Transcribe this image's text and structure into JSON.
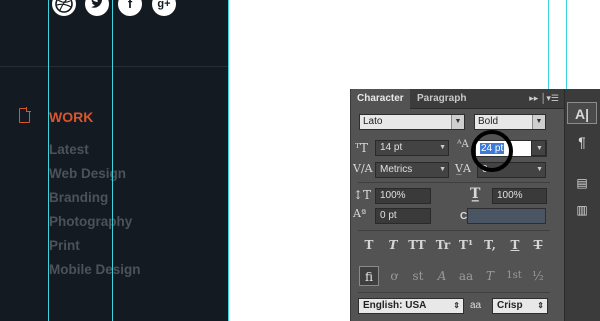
{
  "site": {
    "social_icons": [
      "dribbble-icon",
      "twitter-icon",
      "facebook-icon",
      "google-plus-icon"
    ],
    "social_glyphs": {
      "facebook": "f",
      "google_plus": "g+"
    },
    "active_item": "WORK",
    "menu_items": [
      "Latest",
      "Web Design",
      "Branding",
      "Photography",
      "Print",
      "Mobile Design"
    ],
    "colors": {
      "background": "#141a21",
      "accent": "#d8562e",
      "muted_text": "#4b525c",
      "guide": "#3fd3e0"
    }
  },
  "character_panel": {
    "tabs": [
      "Character",
      "Paragraph"
    ],
    "font_family": "Lato",
    "font_style": "Bold",
    "font_size": "14 pt",
    "leading": "24 pt",
    "kerning": "Metrics",
    "tracking": "0",
    "vertical_scale": "100%",
    "horizontal_scale": "100%",
    "baseline_shift": "0 pt",
    "color_label": "Color:",
    "color_value": "#4a5563",
    "language": "English: USA",
    "antialias_symbol": "aa",
    "antialiasing": "Crisp",
    "style_buttons": [
      "T",
      "T",
      "TT",
      "Tr",
      "T¹",
      "T,",
      "T",
      "T"
    ],
    "feature_buttons": [
      "fi",
      "ơ",
      "st",
      "A",
      "aa",
      "T",
      "1st",
      "½"
    ]
  },
  "dock": {
    "buttons": [
      "character-panel-icon",
      "paragraph-panel-icon",
      "character-styles-icon",
      "paragraph-styles-icon"
    ]
  }
}
